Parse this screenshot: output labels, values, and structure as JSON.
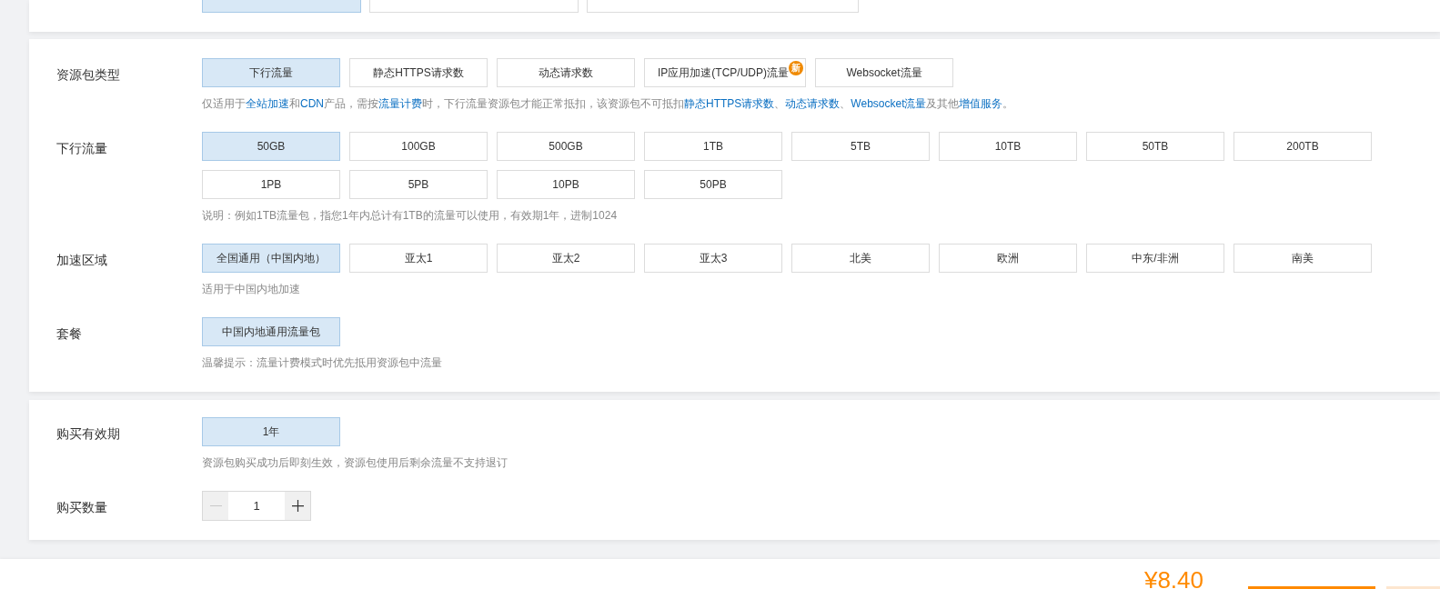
{
  "product_type": {
    "options": [
      {
        "selected": true
      },
      {
        "selected": false
      },
      {
        "selected": false
      }
    ]
  },
  "package_config": {
    "rows": [
      {
        "label": "资源包类型",
        "options": [
          {
            "label": "下行流量",
            "selected": true
          },
          {
            "label": "静态HTTPS请求数",
            "selected": false
          },
          {
            "label": "动态请求数",
            "selected": false
          },
          {
            "label": "IP应用加速(TCP/UDP)流量",
            "selected": false,
            "badge": "新"
          },
          {
            "label": "Websocket流量",
            "selected": false
          }
        ],
        "note": [
          {
            "kind": "text",
            "text": "仅适用于"
          },
          {
            "kind": "link",
            "text": "全站加速"
          },
          {
            "kind": "text",
            "text": "和"
          },
          {
            "kind": "link",
            "text": "CDN"
          },
          {
            "kind": "text",
            "text": "产品，需按"
          },
          {
            "kind": "link",
            "text": "流量计费"
          },
          {
            "kind": "text",
            "text": "时，下行流量资源包才能正常抵扣，该资源包不可抵扣"
          },
          {
            "kind": "link",
            "text": "静态HTTPS请求数"
          },
          {
            "kind": "text",
            "text": "、"
          },
          {
            "kind": "link",
            "text": "动态请求数"
          },
          {
            "kind": "text",
            "text": "、"
          },
          {
            "kind": "link",
            "text": "Websocket流量"
          },
          {
            "kind": "text",
            "text": "及其他"
          },
          {
            "kind": "link",
            "text": "增值服务"
          },
          {
            "kind": "text",
            "text": "。"
          }
        ]
      },
      {
        "label": "下行流量",
        "options": [
          {
            "label": "50GB",
            "selected": true
          },
          {
            "label": "100GB",
            "selected": false
          },
          {
            "label": "500GB",
            "selected": false
          },
          {
            "label": "1TB",
            "selected": false
          },
          {
            "label": "5TB",
            "selected": false
          },
          {
            "label": "10TB",
            "selected": false
          },
          {
            "label": "50TB",
            "selected": false
          },
          {
            "label": "200TB",
            "selected": false
          },
          {
            "label": "1PB",
            "selected": false
          },
          {
            "label": "5PB",
            "selected": false
          },
          {
            "label": "10PB",
            "selected": false
          },
          {
            "label": "50PB",
            "selected": false
          }
        ],
        "note": "说明：例如1TB流量包，指您1年内总计有1TB的流量可以使用，有效期1年，进制1024"
      },
      {
        "label": "加速区域",
        "options": [
          {
            "label": "全国通用（中国内地）",
            "selected": true
          },
          {
            "label": "亚太1",
            "selected": false
          },
          {
            "label": "亚太2",
            "selected": false
          },
          {
            "label": "亚太3",
            "selected": false
          },
          {
            "label": "北美",
            "selected": false
          },
          {
            "label": "欧洲",
            "selected": false
          },
          {
            "label": "中东/非洲",
            "selected": false
          },
          {
            "label": "南美",
            "selected": false
          }
        ],
        "note": "适用于中国内地加速"
      },
      {
        "label": "套餐",
        "options": [
          {
            "label": "中国内地通用流量包",
            "selected": true
          }
        ],
        "note": "温馨提示：流量计费模式时优先抵用资源包中流量"
      }
    ]
  },
  "purchase": {
    "rows": [
      {
        "label": "购买有效期",
        "kind": "options",
        "options": [
          {
            "label": "1年",
            "selected": true
          }
        ],
        "note": "资源包购买成功后即刻生效，资源包使用后剩余流量不支持退订"
      },
      {
        "label": "购买数量",
        "kind": "stepper",
        "value": "1",
        "decrease_disabled": true
      }
    ]
  },
  "footer": {
    "total_price": "¥8.40"
  }
}
